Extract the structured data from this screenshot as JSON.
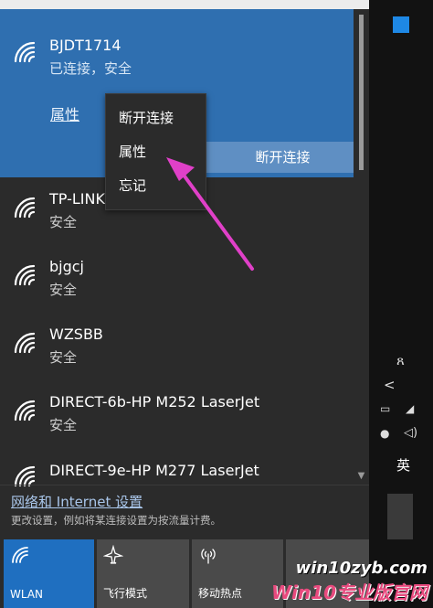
{
  "connected_network": {
    "ssid": "BJDT1714",
    "status": "已连接，安全",
    "properties_link": "属性",
    "disconnect_button": "断开连接"
  },
  "context_menu": {
    "items": [
      "断开连接",
      "属性",
      "忘记"
    ]
  },
  "networks": [
    {
      "ssid": "TP-LINK",
      "status": "安全"
    },
    {
      "ssid": "bjgcj",
      "status": "安全"
    },
    {
      "ssid": "WZSBB",
      "status": "安全"
    },
    {
      "ssid": "DIRECT-6b-HP M252 LaserJet",
      "status": "安全"
    },
    {
      "ssid": "DIRECT-9e-HP M277 LaserJet",
      "status": ""
    }
  ],
  "settings": {
    "link": "网络和 Internet 设置",
    "description": "更改设置，例如将某连接设置为按流量计费。"
  },
  "quick_actions": [
    {
      "label": "WLAN",
      "icon": "wifi-icon",
      "active": true
    },
    {
      "label": "飞行模式",
      "icon": "airplane-icon",
      "active": false
    },
    {
      "label": "移动热点",
      "icon": "hotspot-icon",
      "active": false
    }
  ],
  "taskbar": {
    "ime_label": "英"
  },
  "watermark": {
    "url": "win10zyb.com",
    "brand": "Win10专业版官网"
  },
  "colors": {
    "accent": "#2f6fb0",
    "annotation_arrow": "#e040c8"
  }
}
